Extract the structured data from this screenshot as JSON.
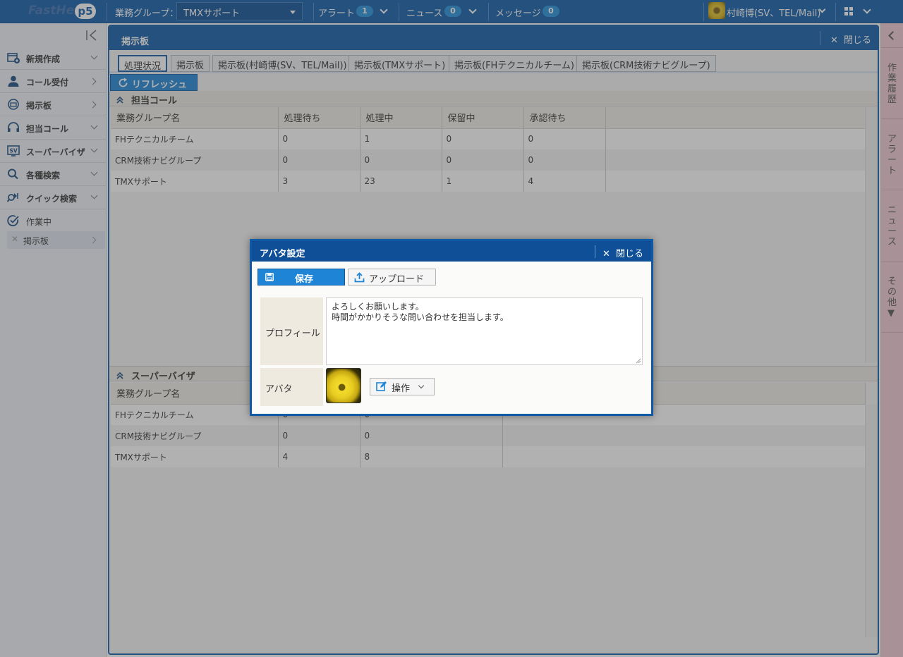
{
  "app": {
    "logo_text": "FastHel",
    "logo_version": "p5"
  },
  "topbar": {
    "group_label": "業務グループ：",
    "group_value": "TMXサポート",
    "alert_label": "アラート",
    "alert_count": "1",
    "news_label": "ニュース",
    "news_count": "0",
    "message_label": "メッセージ",
    "message_count": "0",
    "user_name": "村崎博(SV、TEL/Mail)"
  },
  "sidebar": {
    "items": [
      {
        "label": "新規作成",
        "icon": "new-window-icon"
      },
      {
        "label": "コール受付",
        "icon": "person-icon"
      },
      {
        "label": "掲示板",
        "icon": "bulletin-board-icon"
      },
      {
        "label": "担当コール",
        "icon": "headset-icon"
      },
      {
        "label": "スーパーバイザ",
        "icon": "sv-icon"
      },
      {
        "label": "各種検索",
        "icon": "search-icon"
      },
      {
        "label": "クイック検索",
        "icon": "quick-search-icon"
      },
      {
        "label": "作業中",
        "icon": "check-circle-icon"
      }
    ],
    "sub_item": "掲示板"
  },
  "main": {
    "title": "掲示板",
    "close_label": "閉じる",
    "tabs": [
      "処理状況",
      "掲示板",
      "掲示板(村崎博(SV、TEL/Mail))",
      "掲示板(TMXサポート)",
      "掲示板(FHテクニカルチーム)",
      "掲示板(CRM技術ナビグループ)"
    ],
    "refresh_label": "リフレッシュ",
    "calls_section": {
      "title": "担当コール",
      "headers": [
        "業務グループ名",
        "処理待ち",
        "処理中",
        "保留中",
        "承認待ち"
      ],
      "rows": [
        [
          "FHテクニカルチーム",
          "0",
          "1",
          "0",
          "0"
        ],
        [
          "CRM技術ナビグループ",
          "0",
          "0",
          "0",
          "0"
        ],
        [
          "TMXサポート",
          "3",
          "23",
          "1",
          "4"
        ]
      ]
    },
    "sv_section": {
      "title": "スーパーバイザ",
      "headers": [
        "業務グループ名"
      ],
      "rows": [
        [
          "FHテクニカルチーム",
          "0",
          "0"
        ],
        [
          "CRM技術ナビグループ",
          "0",
          "0"
        ],
        [
          "TMXサポート",
          "4",
          "8"
        ]
      ]
    }
  },
  "rightpane": [
    "作業履歴",
    "アラート",
    "ニュース",
    "その他▼"
  ],
  "dialog": {
    "title": "アバタ設定",
    "close_label": "閉じる",
    "save_label": "保存",
    "upload_label": "アップロード",
    "profile_label": "プロフィール",
    "profile_lines": [
      "よろしくお願いします。",
      "時間がかかりそうな問い合わせを担当します。"
    ],
    "avatar_label": "アバタ",
    "operation_label": "操作"
  },
  "colors": {
    "brand": "#0e5aa7",
    "accent": "#1e85d6",
    "rightpane": "#f0c8d2"
  }
}
